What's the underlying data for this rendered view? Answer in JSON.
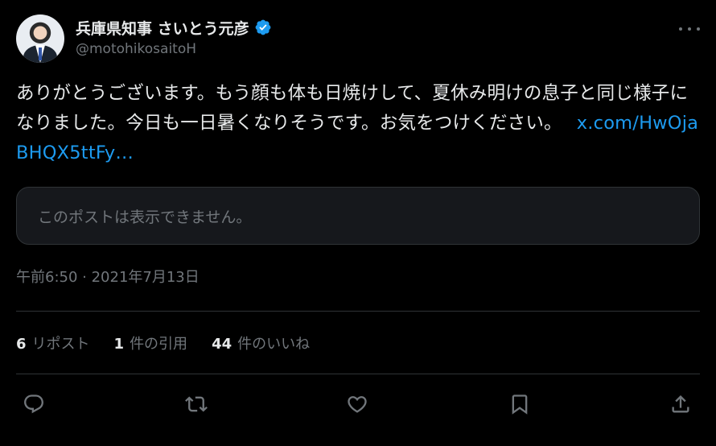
{
  "user": {
    "display_name": "兵庫県知事 さいとう元彦",
    "handle": "@motohikosaitoH",
    "verified": true,
    "verified_color": "#1d9bf0"
  },
  "tweet": {
    "text": "ありがとうございます。もう顔も体も日焼けして、夏休み明けの息子と同じ様子になりました。今日も一日暑くなりそうです。お気をつけください。",
    "link": "x.com/HwOjaBHQX5ttFy…"
  },
  "quoted_post": {
    "message": "このポストは表示できません。"
  },
  "timestamp": "午前6:50 · 2021年7月13日",
  "stats": {
    "reposts_count": "6",
    "reposts_label": "リポスト",
    "quotes_count": "1",
    "quotes_label": "件の引用",
    "likes_count": "44",
    "likes_label": "件のいいね"
  },
  "icons": {
    "more": "more-icon",
    "reply": "reply-icon",
    "repost": "repost-icon",
    "like": "like-icon",
    "bookmark": "bookmark-icon",
    "share": "share-icon"
  },
  "colors": {
    "background": "#000000",
    "text": "#e7e9ea",
    "secondary_text": "#71767b",
    "link": "#1d9bf0",
    "border": "#2f3336"
  }
}
